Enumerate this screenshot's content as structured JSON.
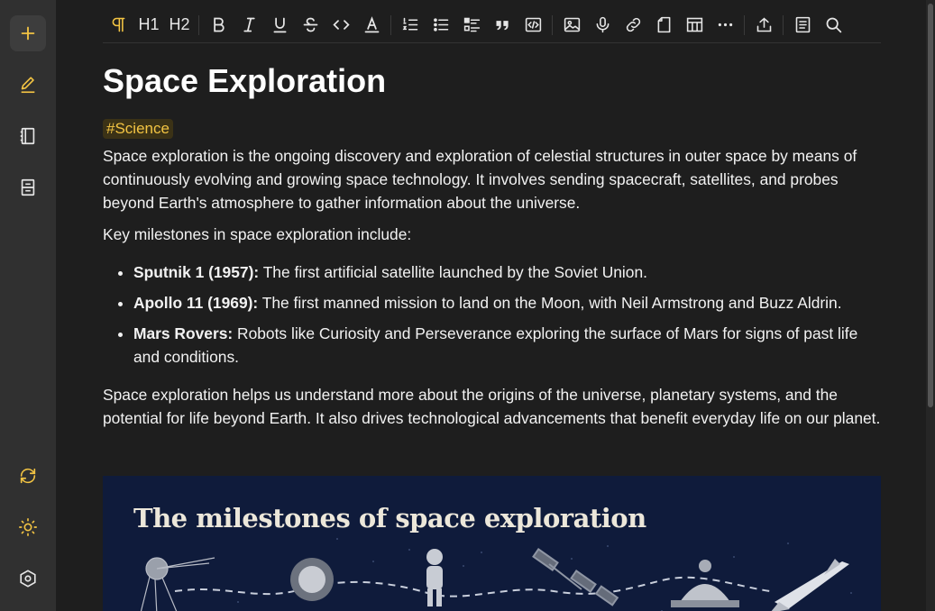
{
  "sidebar": {
    "items": [
      {
        "icon": "plus-icon",
        "active": true
      },
      {
        "icon": "pencil-icon",
        "active": false
      },
      {
        "icon": "notebook-icon",
        "active": false
      },
      {
        "icon": "archive-icon",
        "active": false
      }
    ],
    "bottom": [
      {
        "icon": "sync-icon"
      },
      {
        "icon": "sun-icon"
      },
      {
        "icon": "settings-hexagon-icon"
      }
    ]
  },
  "toolbar": {
    "h1": "H1",
    "h2": "H2"
  },
  "note": {
    "title": "Space Exploration",
    "tag": "#Science",
    "intro": "Space exploration is the ongoing discovery and exploration of celestial structures in outer space by means of continuously evolving and growing space technology. It involves sending spacecraft, satellites, and probes beyond Earth's atmosphere to gather information about the universe.",
    "milestones_lead": "Key milestones in space exploration include:",
    "milestones": [
      {
        "label": "Sputnik 1 (1957):",
        "text": " The first artificial satellite launched by the Soviet Union."
      },
      {
        "label": "Apollo 11 (1969):",
        "text": " The first manned mission to land on the Moon, with Neil Armstrong and Buzz Aldrin."
      },
      {
        "label": "Mars Rovers:",
        "text": " Robots like Curiosity and Perseverance exploring the surface of Mars for signs of past life and conditions."
      }
    ],
    "conclusion": "Space exploration helps us understand more about the origins of the universe, planetary systems, and the potential for life beyond Earth. It also drives technological advancements that benefit everyday life on our planet.",
    "image_title": "The milestones of space exploration"
  },
  "colors": {
    "accent": "#f3c443",
    "background": "#1e1e1e",
    "sidebar": "#303030",
    "image_bg": "#0f1b3b"
  }
}
